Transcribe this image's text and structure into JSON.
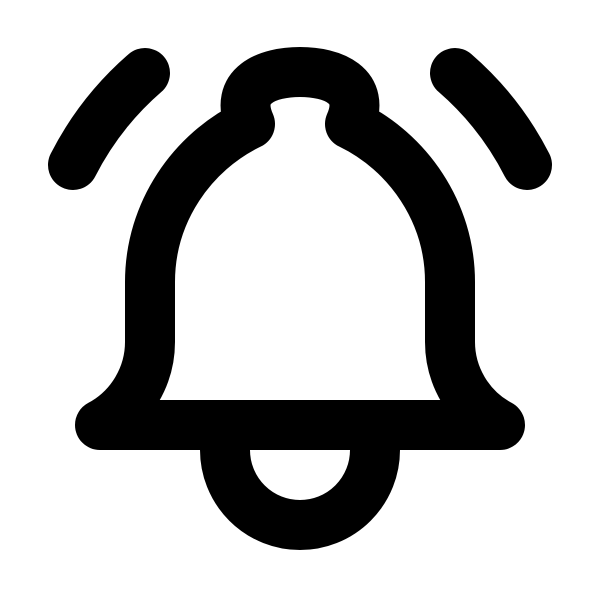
{
  "icon": {
    "name": "bell-ringing-icon",
    "stroke_color": "#000000",
    "background_color": "#ffffff"
  }
}
